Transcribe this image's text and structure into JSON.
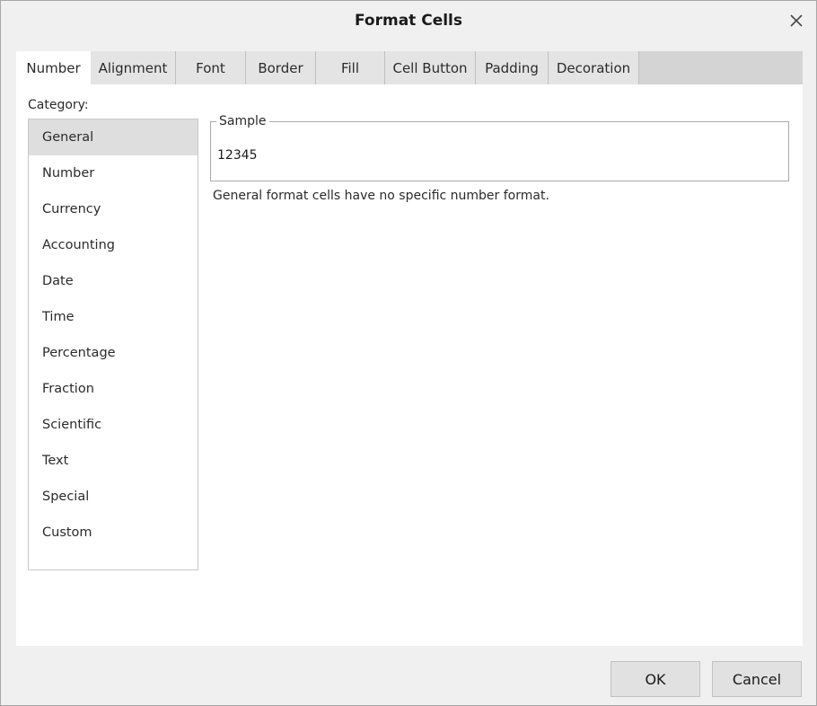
{
  "dialog": {
    "title": "Format Cells",
    "close_icon": "close-icon"
  },
  "tabs": [
    {
      "label": "Number",
      "active": true
    },
    {
      "label": "Alignment"
    },
    {
      "label": "Font"
    },
    {
      "label": "Border"
    },
    {
      "label": "Fill"
    },
    {
      "label": "Cell Button"
    },
    {
      "label": "Padding"
    },
    {
      "label": "Decoration"
    }
  ],
  "number_tab": {
    "category_label": "Category:",
    "categories": [
      {
        "label": "General",
        "selected": true
      },
      {
        "label": "Number"
      },
      {
        "label": "Currency"
      },
      {
        "label": "Accounting"
      },
      {
        "label": "Date"
      },
      {
        "label": "Time"
      },
      {
        "label": "Percentage"
      },
      {
        "label": "Fraction"
      },
      {
        "label": "Scientific"
      },
      {
        "label": "Text"
      },
      {
        "label": "Special"
      },
      {
        "label": "Custom"
      }
    ],
    "sample": {
      "legend": "Sample",
      "value": "12345"
    },
    "description": "General format cells have no specific number format."
  },
  "footer": {
    "ok_label": "OK",
    "cancel_label": "Cancel"
  },
  "colors": {
    "dialog_bg": "#f0f0f0",
    "panel_bg": "#ffffff",
    "selected_item_bg": "#dedede",
    "tab_inactive_bg": "#e4e4e4"
  }
}
